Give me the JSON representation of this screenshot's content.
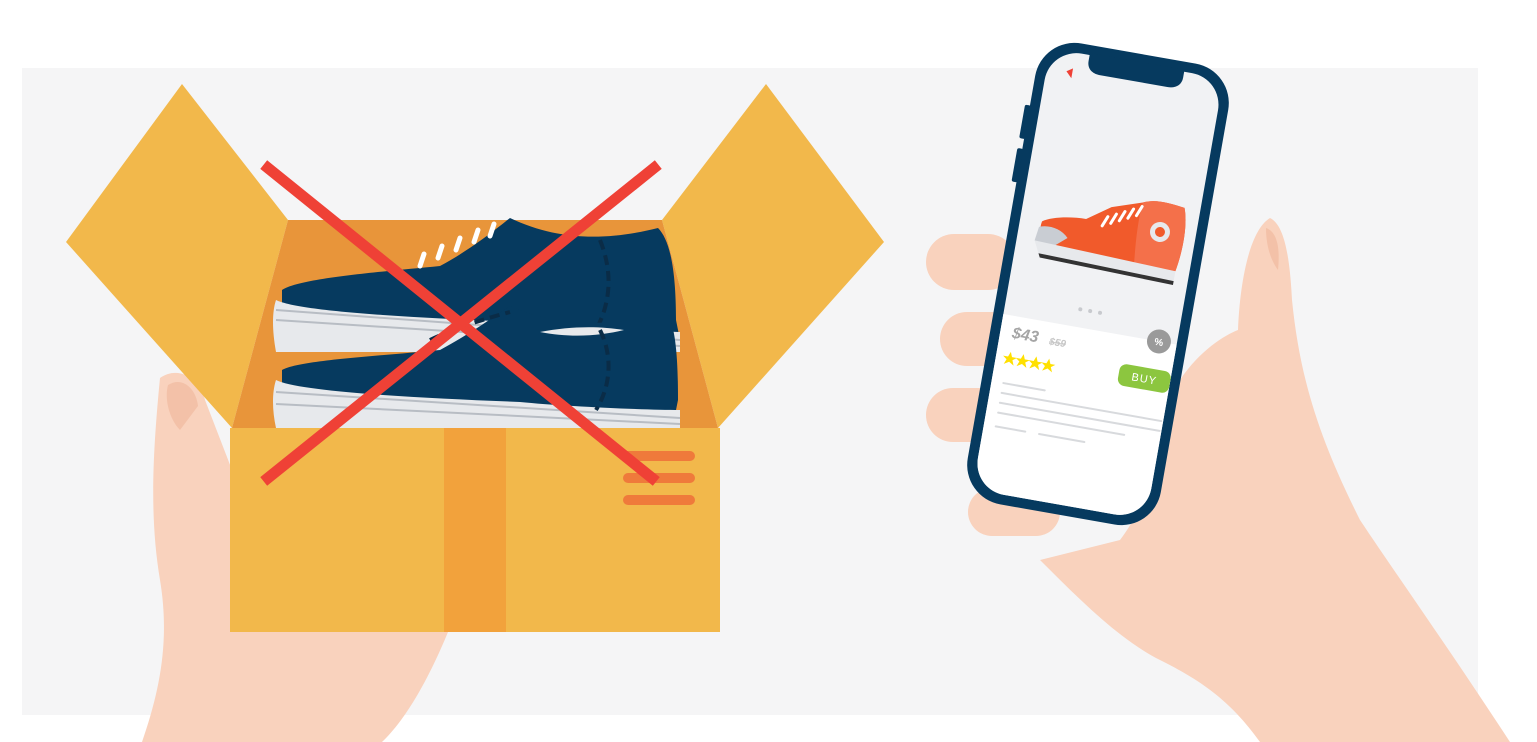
{
  "product": {
    "price": "$43",
    "old_price": "$59",
    "rating_stars": 4,
    "buy_label": "BUY",
    "discount_badge": "%",
    "carousel_dots": 3
  },
  "colors": {
    "background": "#F5F5F6",
    "box_light": "#F2B84B",
    "box_dark": "#E8953A",
    "box_tape": "#F2A23C",
    "box_stripes": "#EF7A3B",
    "shoe_navy": "#063A5F",
    "shoe_sole": "#E7E9EC",
    "cross_red": "#EF4136",
    "skin": "#F9D2BD",
    "skin_shadow": "#F3C1A8",
    "phone_frame": "#063A5F",
    "screen_bg": "#F1F2F4",
    "sneaker_orange": "#F15A2B",
    "buy_green": "#8CC63F",
    "star_yellow": "#FFE000",
    "badge_gray": "#9A9A9A",
    "text_gray": "#A5A5A5"
  },
  "icons": [
    "cross-mark-icon",
    "back-marker-icon",
    "star-icon",
    "percent-badge-icon"
  ]
}
